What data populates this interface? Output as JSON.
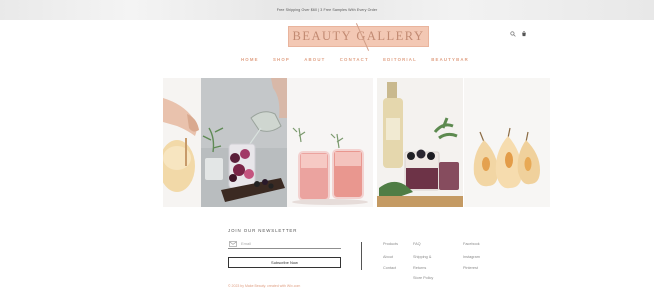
{
  "banner": {
    "text": "Free Shipping Over $60 | 3 Free Samples With Every Order"
  },
  "brand": {
    "logo_text": "BEAUTY GALLERY",
    "accent": "#e0a185",
    "logo_bg": "#f3c8b4"
  },
  "header_icons": [
    "search-icon",
    "cart-icon"
  ],
  "nav": {
    "items": [
      "HOME",
      "SHOP",
      "ABOUT",
      "CONTACT",
      "EDITORIAL",
      "BEAUTYBAR"
    ]
  },
  "gallery": {
    "photos": [
      "peach-cocktail-photo",
      "blackberry-cocktail-photo",
      "pink-cocktail-photo",
      "bottle-cocktail-photo",
      "pear-dessert-photo"
    ]
  },
  "footer": {
    "newsletter_title": "JOIN OUR NEWSLETTER",
    "email_placeholder": "Email",
    "subscribe_label": "Subscribe Now",
    "copyright": "© 2023 by Make Beauty. created with Wix.com",
    "links_col1": [
      "Products",
      "About",
      "Contact"
    ],
    "links_col2": [
      "FAQ",
      "Shipping &",
      "Returns",
      "Store Policy"
    ],
    "links_col3": [
      "Facebook",
      "Instagram",
      "Pinterest"
    ]
  }
}
